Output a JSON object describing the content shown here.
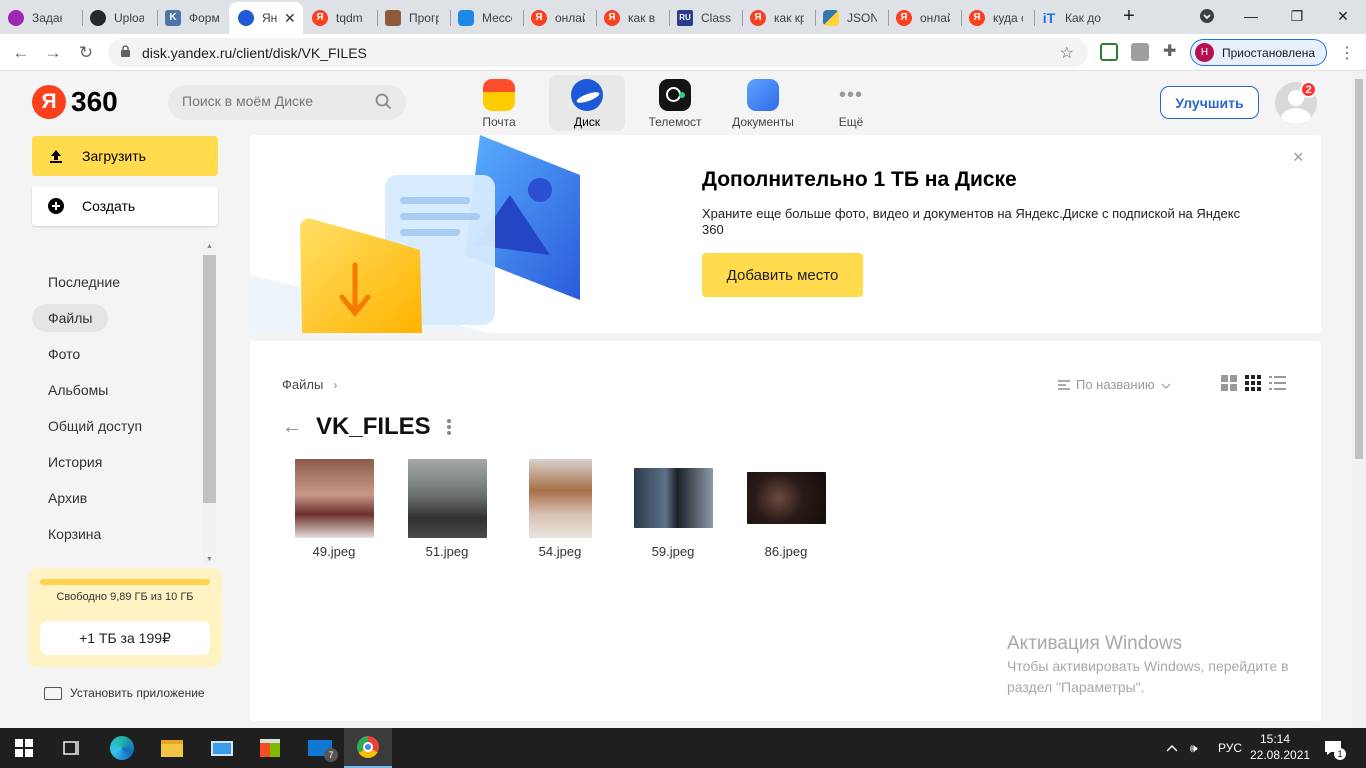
{
  "browser": {
    "tabs": [
      {
        "title": "Задан",
        "icon": "multicolor-icon",
        "color": "#9c27b0"
      },
      {
        "title": "Uploa",
        "icon": "github-icon",
        "color": "#24292e"
      },
      {
        "title": "Форм",
        "icon": "vk-icon",
        "color": "#4a76a8"
      },
      {
        "title": "Ян",
        "icon": "yandex-disk-icon",
        "color": "#1e5ad8"
      },
      {
        "title": "tqdm",
        "icon": "yandex-icon",
        "color": "#fc3f1d"
      },
      {
        "title": "Прогр",
        "icon": "person-icon",
        "color": "#8d5a3b"
      },
      {
        "title": "Мессе",
        "icon": "messenger-icon",
        "color": "#1e88e5"
      },
      {
        "title": "онлай",
        "icon": "yandex-icon",
        "color": "#fc3f1d"
      },
      {
        "title": "как в",
        "icon": "yandex-icon",
        "color": "#fc3f1d"
      },
      {
        "title": "Class",
        "icon": "ru-icon",
        "color": "#2a3c8f"
      },
      {
        "title": "как кр",
        "icon": "yandex-icon",
        "color": "#fc3f1d"
      },
      {
        "title": "JSON",
        "icon": "python-icon",
        "color": "#3776ab"
      },
      {
        "title": "онлай",
        "icon": "yandex-icon",
        "color": "#fc3f1d"
      },
      {
        "title": "куда с",
        "icon": "yandex-icon",
        "color": "#fc3f1d"
      },
      {
        "title": "Как до",
        "icon": "it-icon",
        "color": "#1a73e8"
      }
    ],
    "new_tab": "+",
    "url": "disk.yandex.ru/client/disk/VK_FILES",
    "profile_initial": "Н",
    "profile_label": "Приостановлена"
  },
  "header": {
    "logo_ya": "Я",
    "logo_360": "360",
    "search_placeholder": "Поиск в моём Диске",
    "services": [
      {
        "label": "Почта",
        "icon": "mail-icon"
      },
      {
        "label": "Диск",
        "icon": "disk-icon"
      },
      {
        "label": "Телемост",
        "icon": "telemost-icon"
      },
      {
        "label": "Документы",
        "icon": "documents-icon"
      },
      {
        "label": "Ещё",
        "icon": "more-icon"
      }
    ],
    "upgrade": "Улучшить",
    "notifications": "2"
  },
  "sidebar": {
    "upload": "Загрузить",
    "create": "Создать",
    "items": [
      "Последние",
      "Файлы",
      "Фото",
      "Альбомы",
      "Общий доступ",
      "История",
      "Архив",
      "Корзина"
    ],
    "active": "Файлы",
    "storage_text": "Свободно 9,89 ГБ из 10 ГБ",
    "storage_used_fraction": 0.011,
    "buy_label": "+1 ТБ за 199₽",
    "install_app": "Установить приложение"
  },
  "promo": {
    "title": "Дополнительно 1 ТБ на Диске",
    "description": "Храните еще больше фото, видео и документов на Яндекс.Диске с подпиской на Яндекс 360",
    "button": "Добавить место",
    "close": "×"
  },
  "files": {
    "breadcrumb": "Файлы",
    "sort_label": "По названию",
    "folder_title": "VK_FILES",
    "items": [
      {
        "name": "49.jpeg"
      },
      {
        "name": "51.jpeg"
      },
      {
        "name": "54.jpeg"
      },
      {
        "name": "59.jpeg"
      },
      {
        "name": "86.jpeg"
      }
    ]
  },
  "watermark": {
    "title": "Активация Windows",
    "text": "Чтобы активировать Windows, перейдите в раздел \"Параметры\"."
  },
  "taskbar": {
    "language": "РУС",
    "time": "15:14",
    "date": "22.08.2021",
    "mail_badge": "7",
    "notify_count": "1"
  },
  "colors": {
    "accent_yellow": "#ffdb4d",
    "yandex_red": "#fc3f1d",
    "link_blue": "#2b66c9"
  }
}
